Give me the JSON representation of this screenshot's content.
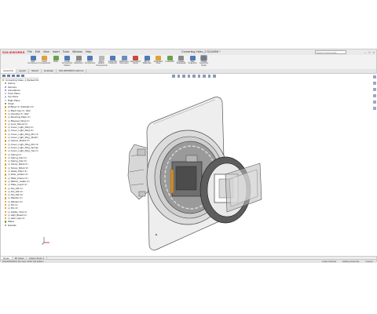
{
  "app": {
    "logo_text": "SOLIDWORKS",
    "title": "Converting Video_2.SLDASM *",
    "search_placeholder": "Search Commands",
    "menu": [
      "File",
      "Edit",
      "View",
      "Insert",
      "Tools",
      "Window",
      "Help"
    ]
  },
  "toolbar": {
    "tools": [
      {
        "label": "Edit Component",
        "color": "#4f79b8"
      },
      {
        "label": "Insert Components",
        "color": "#e0a13a"
      },
      {
        "label": "Mate",
        "color": "#6aa34a"
      },
      {
        "label": "Linear Component Pattern",
        "color": "#4f79b8"
      },
      {
        "label": "Smart Fasteners",
        "color": "#8a8a8a"
      },
      {
        "label": "Move Component",
        "color": "#4f79b8"
      },
      {
        "label": "Show Hidden Components",
        "color": "#b8b8b8"
      },
      {
        "label": "Assembly Features",
        "color": "#4f79b8"
      },
      {
        "label": "Reference Geometry",
        "color": "#6b8cc2"
      },
      {
        "label": "New Motion Study",
        "color": "#c94b3d"
      },
      {
        "label": "Bill of Materials",
        "color": "#4f79b8"
      },
      {
        "label": "Exploded View",
        "color": "#e0a13a"
      },
      {
        "label": "Instant3D",
        "color": "#6aa34a"
      },
      {
        "label": "Update Speedpak",
        "color": "#8a8a8a"
      },
      {
        "label": "Take Snapshot",
        "color": "#4f79b8"
      },
      {
        "label": "Large Assembly Mode",
        "color": "#7a7a7a"
      }
    ]
  },
  "command_tabs": [
    "Assembly",
    "Layout",
    "Sketch",
    "Evaluate",
    "SOLIDWORKS Add-Ins"
  ],
  "feature_tree": {
    "items": [
      {
        "label": "Converting Video_2 (Default<Display State-1>)",
        "color": "#e0a13a",
        "indent": 0
      },
      {
        "label": "History",
        "color": "#8aa0c8",
        "indent": 1
      },
      {
        "label": "Sensors",
        "color": "#8aa0c8",
        "indent": 1
      },
      {
        "label": "Annotations",
        "color": "#8aa0c8",
        "indent": 1
      },
      {
        "label": "Front Plane",
        "color": "#b9c6df",
        "indent": 1
      },
      {
        "label": "Top Plane",
        "color": "#b9c6df",
        "indent": 1
      },
      {
        "label": "Right Plane",
        "color": "#b9c6df",
        "indent": 1
      },
      {
        "label": "Origin",
        "color": "#8a8a8a",
        "indent": 1
      },
      {
        "label": "(f) Base<1> (Default<<D",
        "color": "#e0a13a",
        "indent": 1
      },
      {
        "label": "(-) Back Cap<1> (Def",
        "color": "#e0a13a",
        "indent": 1
      },
      {
        "label": "(-) Housing<1> (Def",
        "color": "#e0a13a",
        "indent": 1
      },
      {
        "label": "(-) Mounting Plate<1>",
        "color": "#e0a13a",
        "indent": 1
      },
      {
        "label": "(-) Bayonet_Ring<1>",
        "color": "#e0a13a",
        "indent": 1
      },
      {
        "label": "(-) Lens_Mount<1>",
        "color": "#e0a13a",
        "indent": 1
      },
      {
        "label": "(-) Cover_Light_Ring<1>",
        "color": "#e0a13a",
        "indent": 1
      },
      {
        "label": "(-) Cover_Light_Ring<2>",
        "color": "#e0a13a",
        "indent": 1
      },
      {
        "label": "(-) Cover_Light_Ring_Rim<1>",
        "color": "#e0a13a",
        "indent": 1
      },
      {
        "label": "(-) Cover_Light_Ring_Shaft<1>",
        "color": "#e0a13a",
        "indent": 1
      },
      {
        "label": "(-) Sensor_Board<1>",
        "color": "#e0a13a",
        "indent": 1
      },
      {
        "label": "(-) Cover_Light_Ring_Rim<2>",
        "color": "#e0a13a",
        "indent": 1
      },
      {
        "label": "(-) Cover_Light_Ring_Spring<1>",
        "color": "#e0a13a",
        "indent": 1
      },
      {
        "label": "(-) Cover_Light_Ring_Top<1>",
        "color": "#e0a13a",
        "indent": 1
      },
      {
        "label": "(-) Spring<1>",
        "color": "#e0a13a",
        "indent": 1
      },
      {
        "label": "(-) Spring_Clip<1>",
        "color": "#e0a13a",
        "indent": 1
      },
      {
        "label": "(-) Spring_Clip<2>",
        "color": "#e0a13a",
        "indent": 1
      },
      {
        "label": "(-) Screw_M2x4<1>",
        "color": "#e0a13a",
        "indent": 1
      },
      {
        "label": "(-) Screw_M2x4<2>",
        "color": "#e0a13a",
        "indent": 1
      },
      {
        "label": "(-) Glass_Filter<1>",
        "color": "#e0a13a",
        "indent": 1
      },
      {
        "label": "(-) Filter_Holder<1>",
        "color": "#e0a13a",
        "indent": 1
      },
      {
        "label": "(-) Slide_Frame<1>",
        "color": "#e0a13a",
        "indent": 1
      },
      {
        "label": "(-) Ribbon_Cable<1>",
        "color": "#e0a13a",
        "indent": 1
      },
      {
        "label": "(-) Plate_Insert<1>",
        "color": "#e0a13a",
        "indent": 1
      },
      {
        "label": "(-) Nut_M2<1>",
        "color": "#e0a13a",
        "indent": 1
      },
      {
        "label": "(-) Nut_M2<2>",
        "color": "#e0a13a",
        "indent": 1
      },
      {
        "label": "(-) Nut_M2<3>",
        "color": "#e0a13a",
        "indent": 1
      },
      {
        "label": "(-) Washer<1>",
        "color": "#e0a13a",
        "indent": 1
      },
      {
        "label": "(-) Washer<2>",
        "color": "#e0a13a",
        "indent": 1
      },
      {
        "label": "(-) Pin<1>",
        "color": "#e0a13a",
        "indent": 1
      },
      {
        "label": "(-) Pin<2>",
        "color": "#e0a13a",
        "indent": 1
      },
      {
        "label": "(-) Holder_Clip<1>",
        "color": "#e0a13a",
        "indent": 1
      },
      {
        "label": "(-) LED_Board<1>",
        "color": "#e0a13a",
        "indent": 1
      },
      {
        "label": "(-) LED_Cap<1>",
        "color": "#e0a13a",
        "indent": 1
      },
      {
        "label": "Mates",
        "color": "#6aa34a",
        "indent": 1
      },
      {
        "label": "Explode",
        "color": "#8aa0c8",
        "indent": 1
      }
    ]
  },
  "bottom_tabs": [
    "Model",
    "3D Views",
    "Motion Study 1"
  ],
  "status": {
    "left": "SOLIDWORKS Premium 2018 x64 Edition",
    "right": [
      "Under Defined",
      "Editing Assembly",
      "Custom"
    ]
  },
  "colors": {
    "accent": "#d1121b",
    "toolbar_bg": "#f2f2f2",
    "viewport_bg": "#ffffff"
  }
}
